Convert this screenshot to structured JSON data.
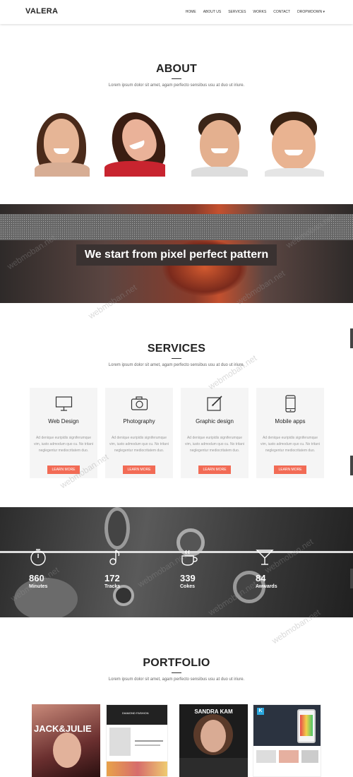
{
  "nav": {
    "logo": "VALERA",
    "items": [
      "HOME",
      "ABOUT US",
      "SERVICES",
      "WORKS",
      "CONTACT",
      "DROPWDOWN ▾"
    ]
  },
  "about": {
    "title": "ABOUT",
    "subtitle": "Lorem ipsum dolor sit amet, agam perfecto sensibus usu at duo ut iriure."
  },
  "banner": {
    "text": "We start from pixel perfect pattern"
  },
  "services": {
    "title": "SERVICES",
    "subtitle": "Lorem ipsum dolor sit amet, agam perfecto sensibus usu at duo ut iriure.",
    "cards": [
      {
        "title": "Web Design",
        "icon": "monitor-icon",
        "desc": "Ad denique euripidis signiferumque vim, iusto admodum quo cu. No tritani neglegentur mediocritatem duo.",
        "button": "LEARN MORE"
      },
      {
        "title": "Photography",
        "icon": "camera-icon",
        "desc": "Ad denique euripidis signiferumque vim, iusto admodum quo cu. No tritani neglegentur mediocritatem duo.",
        "button": "LEARN MORE"
      },
      {
        "title": "Graphic design",
        "icon": "pencil-icon",
        "desc": "Ad denique euripidis signiferumque vim, iusto admodum quo cu. No tritani neglegentur mediocritatem duo.",
        "button": "LEARN MORE"
      },
      {
        "title": "Mobile apps",
        "icon": "phone-icon",
        "desc": "Ad denique euripidis signiferumque vim, iusto admodum quo cu. No tritani neglegentur mediocritatem duo.",
        "button": "LEARN MORE"
      }
    ]
  },
  "stats": [
    {
      "value": "860",
      "label": "Minutes",
      "icon": "clock-icon"
    },
    {
      "value": "172",
      "label": "Tracks",
      "icon": "music-icon"
    },
    {
      "value": "339",
      "label": "Cokes",
      "icon": "cup-icon"
    },
    {
      "value": "84",
      "label": "Awwards",
      "icon": "trophy-icon"
    }
  ],
  "portfolio": {
    "title": "PORTFOLIO",
    "subtitle": "Lorem ipsum dolor sit amet, agam perfecto sensibus usu at duo ut iriure.",
    "items": [
      {
        "caption": "JACK&JULIE"
      },
      {
        "caption": "DIAMOND FASHION"
      },
      {
        "caption": "SANDRA KAM"
      },
      {
        "caption": "K"
      }
    ]
  },
  "watermark": "webmoban.net",
  "colors": {
    "accent": "#f26b55",
    "dark": "#222222",
    "card": "#f5f5f5"
  }
}
